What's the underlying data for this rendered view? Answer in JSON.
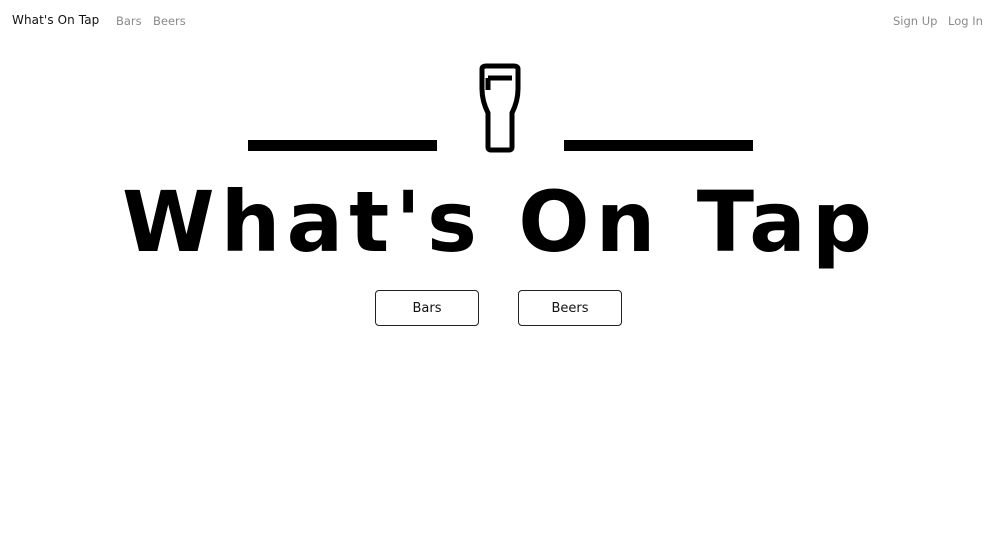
{
  "navbar": {
    "brand": "What's On Tap",
    "left_links": [
      "Bars",
      "Beers"
    ],
    "right_links": [
      "Sign Up",
      "Log In"
    ]
  },
  "hero": {
    "logo_icon": "pint-glass-icon",
    "title": "What's On Tap",
    "buttons": [
      "Bars",
      "Beers"
    ]
  },
  "colors": {
    "text": "#000000",
    "nav_muted": "#8a8a8a",
    "background": "#ffffff"
  }
}
